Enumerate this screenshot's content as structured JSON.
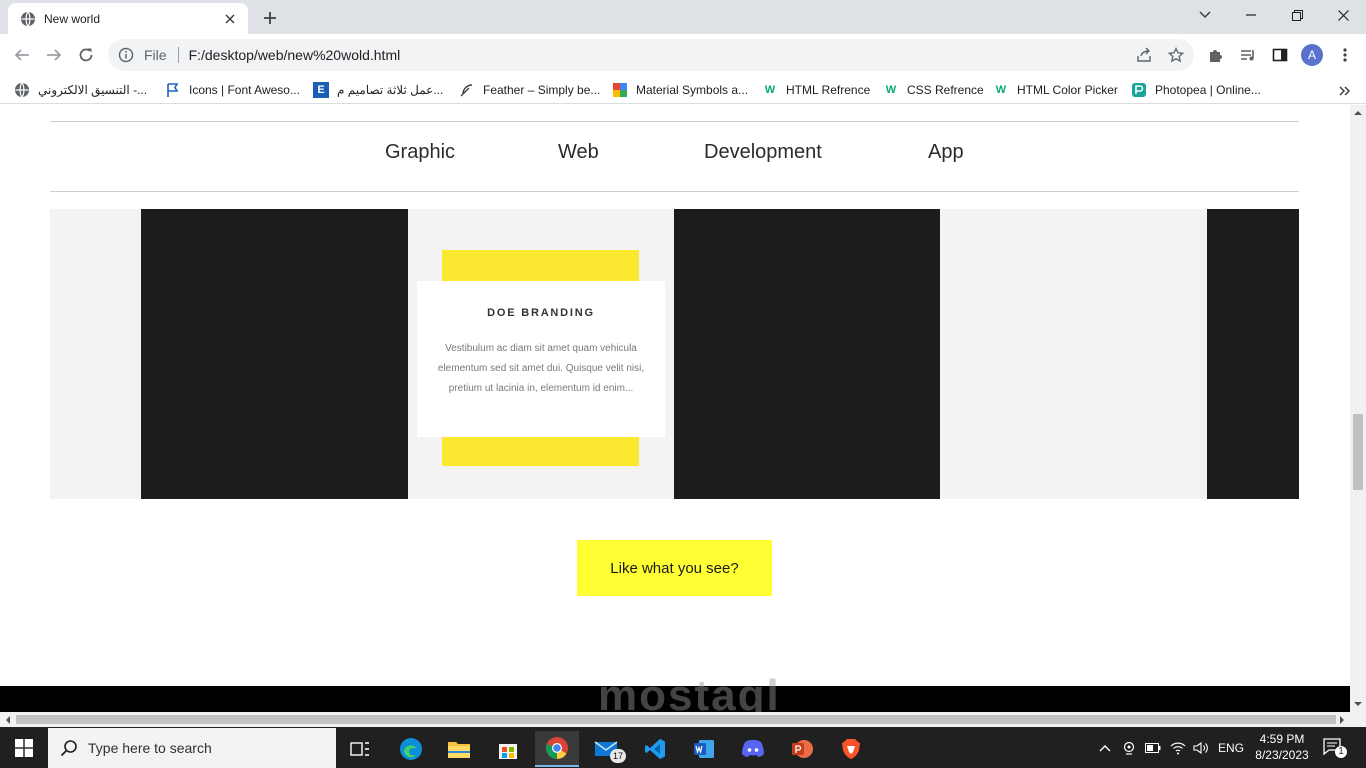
{
  "browser": {
    "tab": {
      "title": "New world"
    },
    "address": {
      "scheme": "File",
      "url": "F:/desktop/web/new%20wold.html"
    },
    "profile_initial": "A"
  },
  "bookmarks": [
    {
      "label": "التنسيق الالكتروني -...",
      "icon": "globe-icon"
    },
    {
      "label": "Icons | Font Aweso...",
      "icon": "flag-icon"
    },
    {
      "label": "عمل ثلاثة تصاميم م...",
      "icon": "e-icon",
      "glyph": "E"
    },
    {
      "label": "Feather – Simply be...",
      "icon": "feather-icon"
    },
    {
      "label": "Material Symbols a...",
      "icon": "material-icon"
    },
    {
      "label": "HTML Refrence",
      "icon": "w3schools-icon",
      "glyph": "W"
    },
    {
      "label": "CSS Refrence",
      "icon": "w3schools-icon",
      "glyph": "W"
    },
    {
      "label": "HTML Color Picker",
      "icon": "w3schools-icon",
      "glyph": "W"
    },
    {
      "label": "Photopea | Online...",
      "icon": "photopea-icon"
    }
  ],
  "page": {
    "categories": [
      "Graphic",
      "Web",
      "Development",
      "App"
    ],
    "card": {
      "title": "DOE BRANDING",
      "description": "Vestibulum ac diam sit amet quam vehicula elementum sed sit amet dui. Quisque velit nisi, pretium ut lacinia in, elementum id enim..."
    },
    "cta_label": "Like what you see?",
    "watermark": "mostaql"
  },
  "taskbar": {
    "search_placeholder": "Type here to search",
    "mail_badge": "17",
    "language": "ENG",
    "time": "4:59 PM",
    "date": "8/23/2023",
    "notification_count": "1"
  },
  "colors": {
    "accent_yellow": "#ffff33",
    "card_yellow": "#fbe830",
    "dark_panel": "#1c1c1c",
    "gallery_bg": "#f3f3f3",
    "taskbar": "#202020"
  }
}
